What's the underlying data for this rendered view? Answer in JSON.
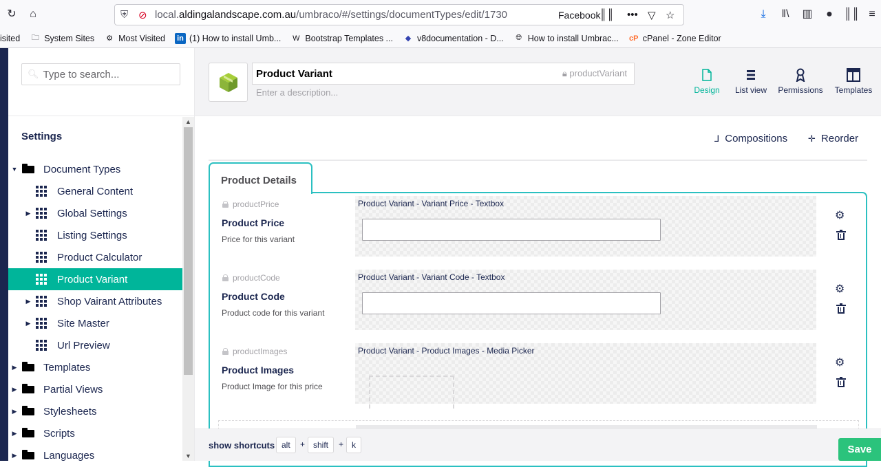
{
  "browser": {
    "url_prefix": "local.",
    "url_host": "aldingalandscape.com.au",
    "url_path": "/umbraco/#/settings/documentTypes/edit/1730",
    "container": "Facebook",
    "bookmarks": [
      {
        "label": "isited",
        "icon": "none"
      },
      {
        "label": "System Sites",
        "icon": "folder-icon"
      },
      {
        "label": "Most Visited",
        "icon": "gear-icon"
      },
      {
        "label": "(1) How to install Umb...",
        "icon": "linkedin-icon"
      },
      {
        "label": "Bootstrap Templates ...",
        "icon": "w-icon"
      },
      {
        "label": "v8documentation - D...",
        "icon": "umbraco-icon"
      },
      {
        "label": "How to install Umbrac...",
        "icon": "globe-icon"
      },
      {
        "label": "cPanel - Zone Editor",
        "icon": "cpanel-icon"
      }
    ]
  },
  "sidebar": {
    "search_placeholder": "Type to search...",
    "section_title": "Settings",
    "items": [
      {
        "label": "Document Types",
        "icon": "folder-icon",
        "caret": "open",
        "level": 0
      },
      {
        "label": "General Content",
        "icon": "grid-icon",
        "caret": "none",
        "level": 1
      },
      {
        "label": "Global Settings",
        "icon": "grid-icon",
        "caret": "closed",
        "level": 1
      },
      {
        "label": "Listing Settings",
        "icon": "grid-icon",
        "caret": "none",
        "level": 1
      },
      {
        "label": "Product Calculator",
        "icon": "grid-icon",
        "caret": "none",
        "level": 1
      },
      {
        "label": "Product Variant",
        "icon": "grid-icon",
        "caret": "none",
        "level": 1,
        "active": true
      },
      {
        "label": "Shop Vairant Attributes",
        "icon": "grid-icon",
        "caret": "closed",
        "level": 1
      },
      {
        "label": "Site Master",
        "icon": "grid-icon",
        "caret": "closed",
        "level": 1
      },
      {
        "label": "Url Preview",
        "icon": "grid-icon",
        "caret": "none",
        "level": 1
      },
      {
        "label": "Templates",
        "icon": "folder-icon",
        "caret": "closed",
        "level": 0
      },
      {
        "label": "Partial Views",
        "icon": "folder-icon",
        "caret": "closed",
        "level": 0
      },
      {
        "label": "Stylesheets",
        "icon": "folder-icon",
        "caret": "closed",
        "level": 0
      },
      {
        "label": "Scripts",
        "icon": "folder-icon",
        "caret": "closed",
        "level": 0
      },
      {
        "label": "Languages",
        "icon": "folder-icon",
        "caret": "closed",
        "level": 0
      }
    ]
  },
  "header": {
    "name": "Product Variant",
    "alias": "productVariant",
    "description_placeholder": "Enter a description...",
    "tabs": [
      {
        "label": "Design",
        "icon": "document-icon",
        "active": true
      },
      {
        "label": "List view",
        "icon": "list-icon"
      },
      {
        "label": "Permissions",
        "icon": "medal-icon"
      },
      {
        "label": "Templates",
        "icon": "layout-icon"
      }
    ]
  },
  "toolbar": {
    "compositions": "Compositions",
    "reorder": "Reorder"
  },
  "group": {
    "name": "Product Details",
    "properties": [
      {
        "alias": "productPrice",
        "label": "Product Price",
        "description": "Price for this variant",
        "editor": "Product Variant - Variant Price - Textbox",
        "type": "textbox"
      },
      {
        "alias": "productCode",
        "label": "Product Code",
        "description": "Product code for this variant",
        "editor": "Product Variant - Variant Code - Textbox",
        "type": "textbox"
      },
      {
        "alias": "productImages",
        "label": "Product Images",
        "description": "Product Image for this price",
        "editor": "Product Variant - Product Images - Media Picker",
        "type": "media"
      }
    ]
  },
  "footer": {
    "shortcuts_label": "show shortcuts",
    "keys": [
      "alt",
      "shift",
      "k"
    ],
    "plus": "+",
    "save": "Save"
  },
  "colors": {
    "accent": "#00b59a",
    "group_border": "#2bc0c1",
    "save": "#2bc37c",
    "nav": "#1b264f"
  }
}
